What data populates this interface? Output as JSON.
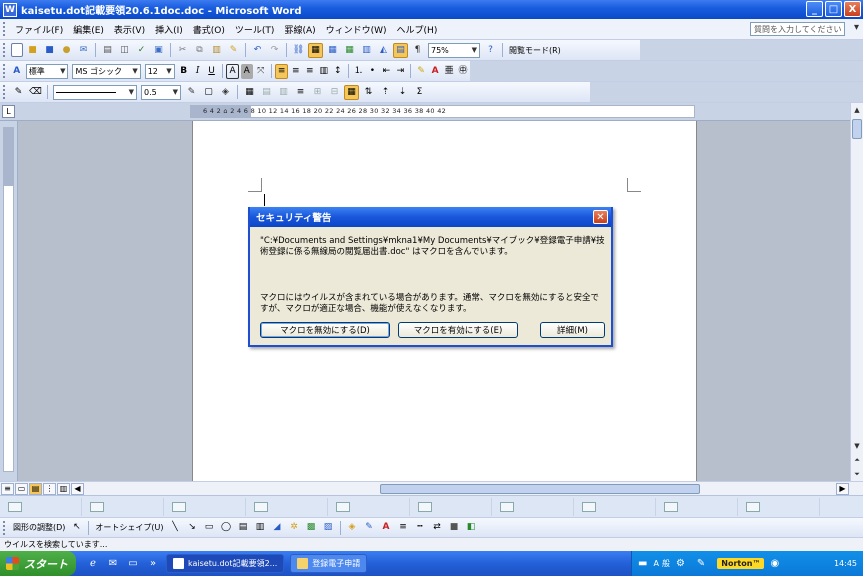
{
  "window": {
    "title": "kaisetu.dot記載要領20.6.1doc.doc - Microsoft Word",
    "icon": "W",
    "buttons": {
      "minimize": "_",
      "maximize": "□",
      "close": "X"
    }
  },
  "menubar": {
    "items": [
      "ファイル(F)",
      "編集(E)",
      "表示(V)",
      "挿入(I)",
      "書式(O)",
      "ツール(T)",
      "罫線(A)",
      "ウィンドウ(W)",
      "ヘルプ(H)"
    ],
    "help_placeholder": "質問を入力してください",
    "close_glyph": "▾"
  },
  "standard_toolbar": {
    "zoom": "75%",
    "reading_mode": "閲覧モード(R)"
  },
  "format_toolbar": {
    "style": "標準",
    "font": "MS ゴシック",
    "size": "12",
    "bold": "B",
    "italic": "I",
    "underline": "U"
  },
  "tables_toolbar": {
    "line_weight": "0.5"
  },
  "ruler": {
    "numbers": "6  4  2  ⌂  2  4  6  8  10  12  14  16  18  20  22  24  26  28  30  32  34  36  38  40  42"
  },
  "dialog": {
    "title": "セキュリティ警告",
    "message": "\"C:¥Documents and Settings¥mkna1¥My Documents¥マイブック¥登録電子申請¥技術登録に係る無線局の閲覧届出書.doc\" はマクロを含んでいます。",
    "warning": "マクロにはウイルスが含まれている場合があります。通常、マクロを無効にすると安全ですが、マクロが適正な場合、機能が使えなくなります。",
    "buttons": {
      "disable": "マクロを無効にする(D)",
      "enable": "マクロを有効にする(E)",
      "details": "詳細(M)"
    }
  },
  "draw_toolbar": {
    "draw_menu": "図形の調整(D)",
    "autoshapes": "オートシェイプ(U)"
  },
  "status": {
    "text": "ウイルスを検索しています..."
  },
  "taskbar": {
    "start": "スタート",
    "buttons": [
      "kaisetu.dot記載要領2...",
      "登録電子申請"
    ],
    "tray_items": [
      "A",
      "般"
    ],
    "norton": "Norton™",
    "clock": "14:45"
  },
  "colors": {
    "title_blue": "#0a49c8",
    "dialog_border": "#1e4fd2",
    "taskbar_blue": "#2460d8",
    "start_green": "#2f8f2a"
  }
}
